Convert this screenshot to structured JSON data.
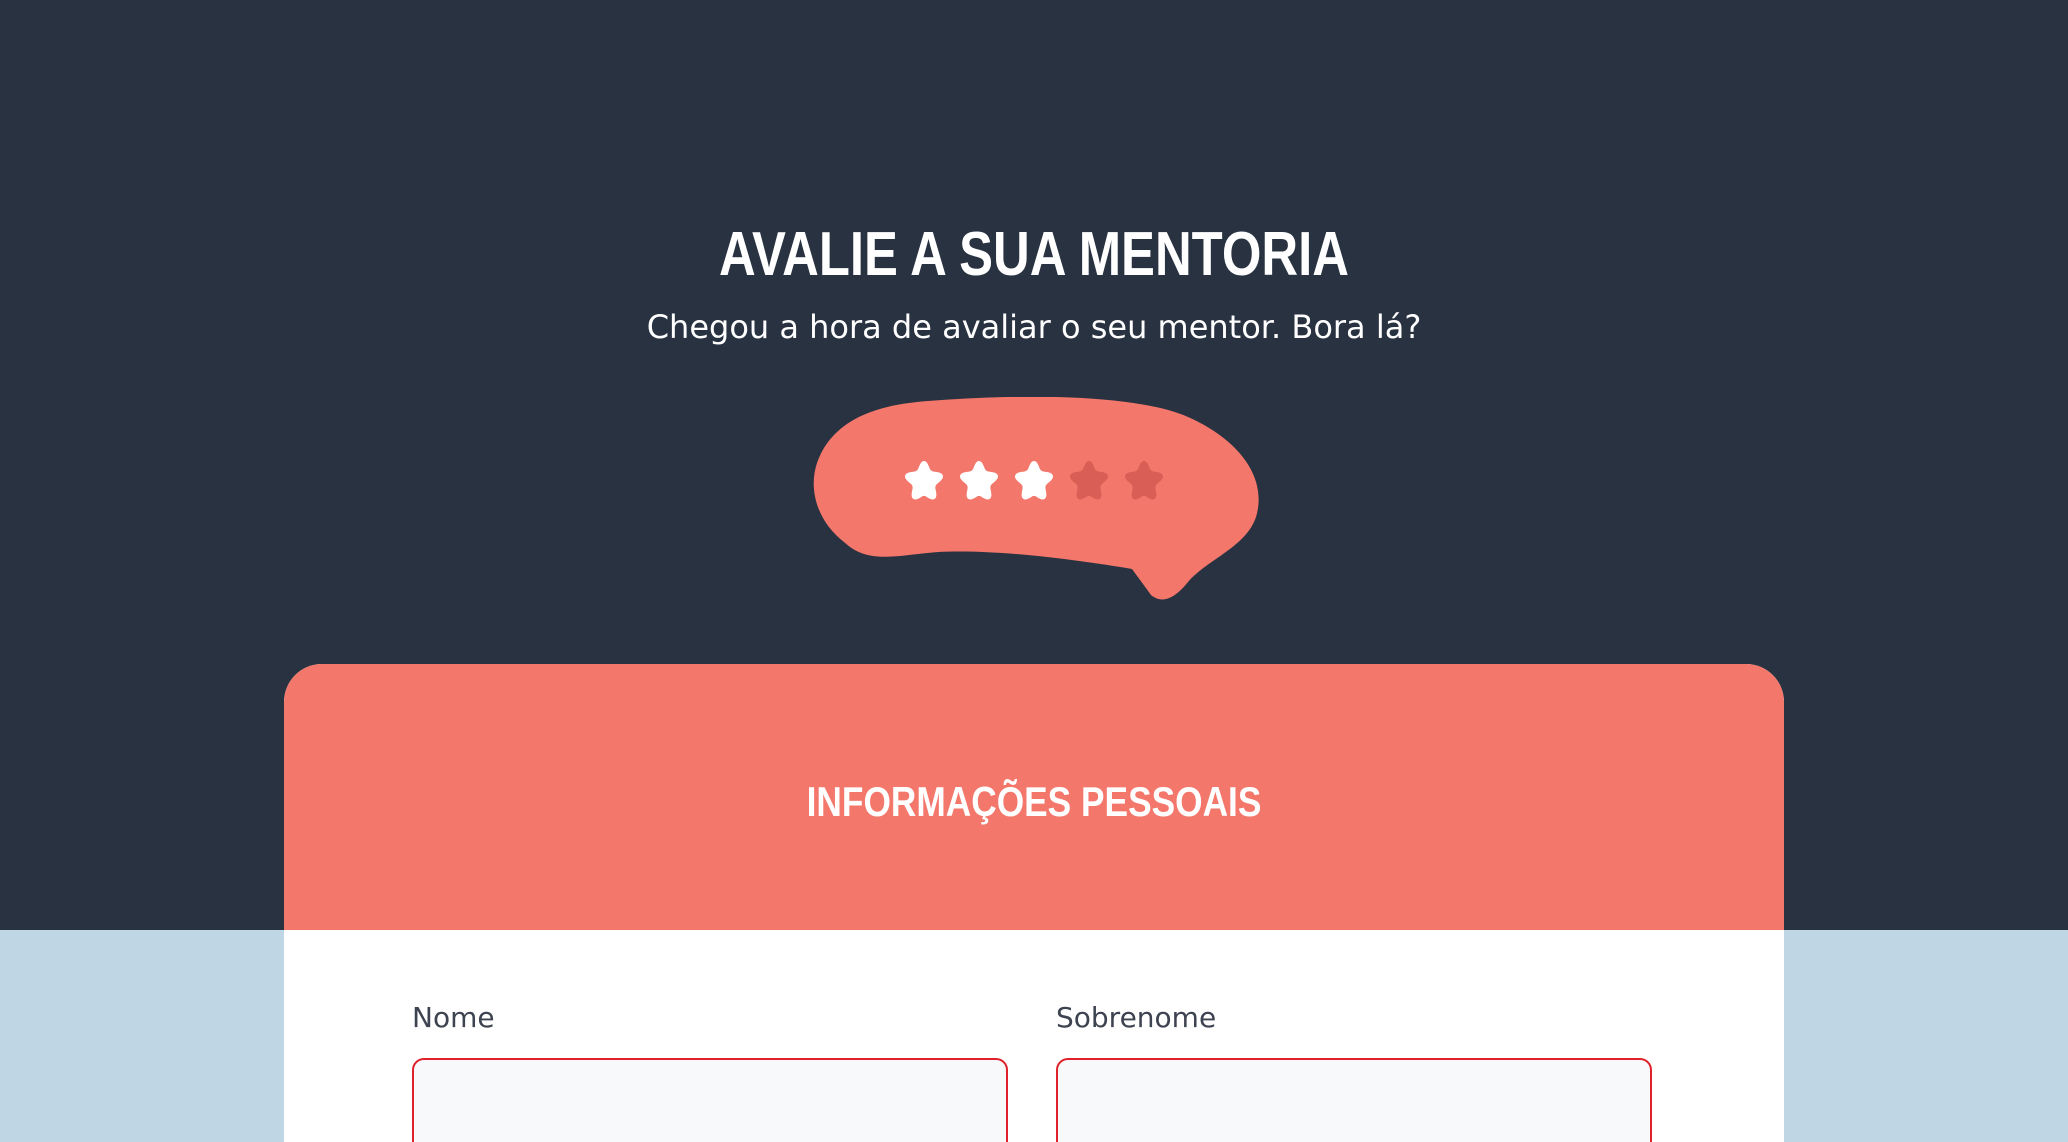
{
  "hero": {
    "title": "AVALIE A SUA MENTORIA",
    "subtitle": "Chegou a hora de avaliar o seu mentor. Bora lá?"
  },
  "rating": {
    "value": 3,
    "max": 5,
    "stars": [
      "star-icon",
      "star-icon",
      "star-icon",
      "star-icon",
      "star-icon"
    ]
  },
  "form": {
    "section_title": "INFORMAÇÕES PESSOAIS",
    "first_name": {
      "label": "Nome",
      "value": "",
      "placeholder": ""
    },
    "last_name": {
      "label": "Sobrenome",
      "value": "",
      "placeholder": ""
    }
  },
  "colors": {
    "dark_background": "#293241",
    "accent": "#f4776b",
    "light_background": "#bfd7e4",
    "star_filled": "#ffffff",
    "star_empty": "#d95e55",
    "input_border": "#e0212a"
  }
}
